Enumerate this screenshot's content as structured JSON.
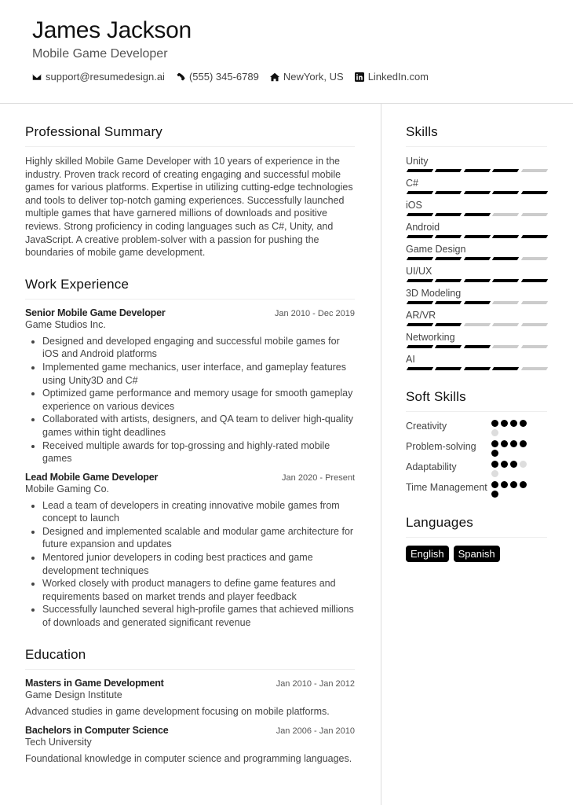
{
  "header": {
    "name": "James Jackson",
    "title": "Mobile Game Developer",
    "contacts": [
      {
        "icon": "envelope-icon",
        "text": "support@resumedesign.ai"
      },
      {
        "icon": "phone-icon",
        "text": "(555) 345-6789"
      },
      {
        "icon": "home-icon",
        "text": "NewYork, US"
      },
      {
        "icon": "linkedin-icon",
        "text": "LinkedIn.com"
      }
    ]
  },
  "summary": {
    "heading": "Professional Summary",
    "text": "Highly skilled Mobile Game Developer with 10 years of experience in the industry. Proven track record of creating engaging and successful mobile games for various platforms. Expertise in utilizing cutting-edge technologies and tools to deliver top-notch gaming experiences. Successfully launched multiple games that have garnered millions of downloads and positive reviews. Strong proficiency in coding languages such as C#, Unity, and JavaScript. A creative problem-solver with a passion for pushing the boundaries of mobile game development."
  },
  "experience": {
    "heading": "Work Experience",
    "jobs": [
      {
        "role": "Senior Mobile Game Developer",
        "dates": "Jan 2010 - Dec 2019",
        "company": "Game Studios Inc.",
        "bullets": [
          "Designed and developed engaging and successful mobile games for iOS and Android platforms",
          "Implemented game mechanics, user interface, and gameplay features using Unity3D and C#",
          "Optimized game performance and memory usage for smooth gameplay experience on various devices",
          "Collaborated with artists, designers, and QA team to deliver high-quality games within tight deadlines",
          "Received multiple awards for top-grossing and highly-rated mobile games"
        ]
      },
      {
        "role": "Lead Mobile Game Developer",
        "dates": "Jan 2020 - Present",
        "company": "Mobile Gaming Co.",
        "bullets": [
          "Lead a team of developers in creating innovative mobile games from concept to launch",
          "Designed and implemented scalable and modular game architecture for future expansion and updates",
          "Mentored junior developers in coding best practices and game development techniques",
          "Worked closely with product managers to define game features and requirements based on market trends and player feedback",
          "Successfully launched several high-profile games that achieved millions of downloads and generated significant revenue"
        ]
      }
    ]
  },
  "education": {
    "heading": "Education",
    "items": [
      {
        "degree": "Masters in Game Development",
        "dates": "Jan 2010 - Jan 2012",
        "school": "Game Design Institute",
        "desc": "Advanced studies in game development focusing on mobile platforms."
      },
      {
        "degree": "Bachelors in Computer Science",
        "dates": "Jan 2006 - Jan 2010",
        "school": "Tech University",
        "desc": "Foundational knowledge in computer science and programming languages."
      }
    ]
  },
  "skills": {
    "heading": "Skills",
    "max": 5,
    "items": [
      {
        "name": "Unity",
        "level": 4
      },
      {
        "name": "C#",
        "level": 5
      },
      {
        "name": "iOS",
        "level": 3
      },
      {
        "name": "Android",
        "level": 5
      },
      {
        "name": "Game Design",
        "level": 4
      },
      {
        "name": "UI/UX",
        "level": 5
      },
      {
        "name": "3D Modeling",
        "level": 3
      },
      {
        "name": "AR/VR",
        "level": 2
      },
      {
        "name": "Networking",
        "level": 3
      },
      {
        "name": "AI",
        "level": 4
      }
    ]
  },
  "soft_skills": {
    "heading": "Soft Skills",
    "max": 5,
    "items": [
      {
        "name": "Creativity",
        "level": 4
      },
      {
        "name": "Problem-solving",
        "level": 5
      },
      {
        "name": "Adaptability",
        "level": 3
      },
      {
        "name": "Time Management",
        "level": 5
      }
    ]
  },
  "languages": {
    "heading": "Languages",
    "items": [
      "English",
      "Spanish"
    ]
  }
}
